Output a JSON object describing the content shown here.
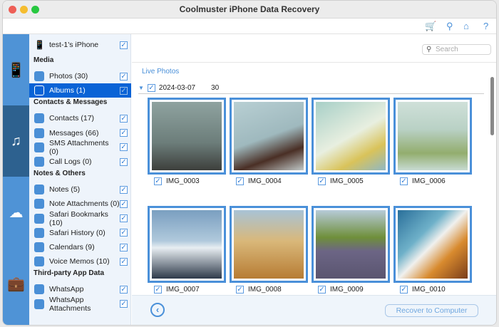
{
  "window": {
    "title": "Coolmuster iPhone Data Recovery"
  },
  "toolbar": {
    "icons": [
      "cart-icon",
      "key-icon",
      "home-icon",
      "help-icon"
    ],
    "help_label": "?"
  },
  "rail": {
    "items": [
      "phone-recovery",
      "itunes-backup-recovery",
      "icloud-recovery",
      "toolkit"
    ],
    "active": 1
  },
  "sidebar": {
    "device": "test-1's iPhone",
    "sections": [
      {
        "title": "Media",
        "items": [
          {
            "label": "Photos (30)",
            "icon": "photos-icon"
          },
          {
            "label": "Albums (1)",
            "icon": "albums-icon",
            "selected": true
          }
        ]
      },
      {
        "title": "Contacts & Messages",
        "items": [
          {
            "label": "Contacts (17)",
            "icon": "contacts-icon"
          },
          {
            "label": "Messages (66)",
            "icon": "messages-icon"
          },
          {
            "label": "SMS Attachments (0)",
            "icon": "sms-attachment-icon"
          },
          {
            "label": "Call Logs (0)",
            "icon": "call-logs-icon"
          }
        ]
      },
      {
        "title": "Notes & Others",
        "items": [
          {
            "label": "Notes (5)",
            "icon": "notes-icon"
          },
          {
            "label": "Note Attachments (0)",
            "icon": "note-attachment-icon"
          },
          {
            "label": "Safari Bookmarks (10)",
            "icon": "safari-bookmarks-icon"
          },
          {
            "label": "Safari History (0)",
            "icon": "safari-history-icon"
          },
          {
            "label": "Calendars (9)",
            "icon": "calendar-icon"
          },
          {
            "label": "Voice Memos (10)",
            "icon": "voice-memo-icon"
          }
        ]
      },
      {
        "title": "Third-party App Data",
        "items": [
          {
            "label": "WhatsApp",
            "icon": "whatsapp-icon"
          },
          {
            "label": "WhatsApp Attachments",
            "icon": "whatsapp-attachment-icon"
          }
        ]
      }
    ]
  },
  "main": {
    "search_placeholder": "Search",
    "album_title": "Live Photos",
    "date": "2024-03-07",
    "count": "30",
    "photos": [
      "IMG_0003",
      "IMG_0004",
      "IMG_0005",
      "IMG_0006",
      "IMG_0007",
      "IMG_0008",
      "IMG_0009",
      "IMG_0010"
    ]
  },
  "footer": {
    "recover_label": "Recover to Computer"
  },
  "colors": {
    "accent": "#4a90d9",
    "rail": "#4f93d6",
    "rail_active": "#2d618f",
    "selected": "#0a63d6"
  }
}
